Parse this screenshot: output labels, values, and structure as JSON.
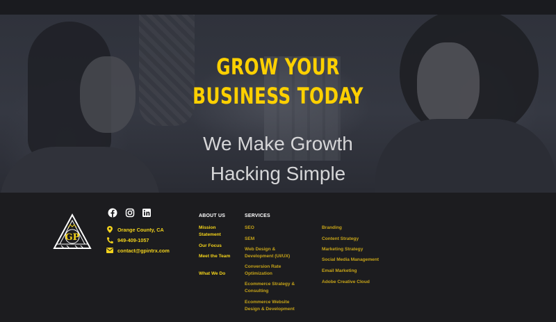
{
  "hero": {
    "title_line1": "GROW YOUR",
    "title_line2": "BUSINESS TODAY",
    "subtitle_line1": "We Make Growth",
    "subtitle_line2": "Hacking Simple"
  },
  "footer": {
    "logo_text": "GP",
    "social": [
      "facebook-icon",
      "instagram-icon",
      "linkedin-icon"
    ],
    "contact": {
      "location": "Orange County, CA",
      "phone": "949-409-1057",
      "email": "contact@gpintrx.com"
    },
    "about": {
      "heading": "ABOUT US",
      "links": [
        "Mission Statement",
        "Our Focus",
        "Meet the Team",
        "What We Do"
      ]
    },
    "services": {
      "heading": "SERVICES",
      "col1": [
        "SEO",
        "SEM",
        "Web Design & Development (UI/UX)",
        "Conversion Rate Optimization",
        "Ecommerce Strategy & Consulting",
        "Ecommerce Website Design & Development"
      ],
      "col2": [
        "Branding",
        "Content Strategy",
        "Marketing Strategy",
        "Social Media Management",
        "Email Marketing",
        "Adobe Creative Cloud"
      ]
    }
  },
  "colors": {
    "accent": "#fdd000",
    "background": "#1c1c1f",
    "hero_overlay": "#33363f"
  }
}
